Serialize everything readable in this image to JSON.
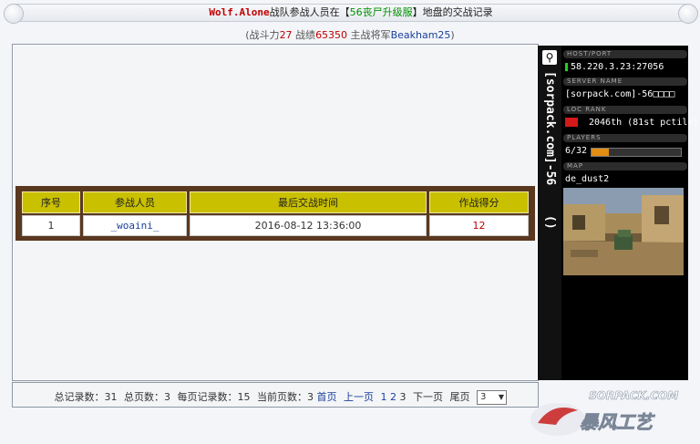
{
  "header": {
    "clan_name": "Wolf.Alone",
    "title_mid": "战队参战人员在【",
    "server_name": "56丧尸升级服",
    "title_end": "】地盘的交战记录"
  },
  "subtitle": {
    "open": "(战斗力",
    "power": "27",
    "score_label": " 战绩",
    "score": "65350",
    "general_label": " 主战将军",
    "general": "Beakham25",
    "close": ")"
  },
  "table": {
    "headers": [
      "序号",
      "参战人员",
      "最后交战时间",
      "作战得分"
    ],
    "rows": [
      {
        "index": "1",
        "player": "_woaini_",
        "time": "2016-08-12 13:36:00",
        "score": "12"
      }
    ]
  },
  "server_banner": {
    "vertical_title": "[sorpack.com]-56",
    "vertical_sub": "()",
    "host_label": "HOST/PORT",
    "host": "58.220.3.23:27056",
    "name_label": "SERVER NAME",
    "name": "[sorpack.com]-56□□□□",
    "rank_label": "LOC   RANK",
    "rank": "2046th (81st pctile)",
    "players_label": "PLAYERS",
    "players": "6/32",
    "players_fill": 0.19,
    "map_label": "MAP",
    "map": "de_dust2",
    "colors": {
      "bar": "#e28d14",
      "status": "#1fd11f",
      "flag": "#d41919"
    }
  },
  "pager": {
    "total_records": "总记录数：31",
    "total_pages": "总页数：3",
    "per_page": "每页记录数：15",
    "current_page": "当前页数：3",
    "first": "首页",
    "prev": "上一页",
    "page1": "1",
    "page2": "2",
    "page3": "3",
    "next": "下一页",
    "last": "尾页",
    "select_value": "3"
  },
  "watermark": {
    "url": "SORPACK.COM",
    "text": "暴风工艺"
  }
}
